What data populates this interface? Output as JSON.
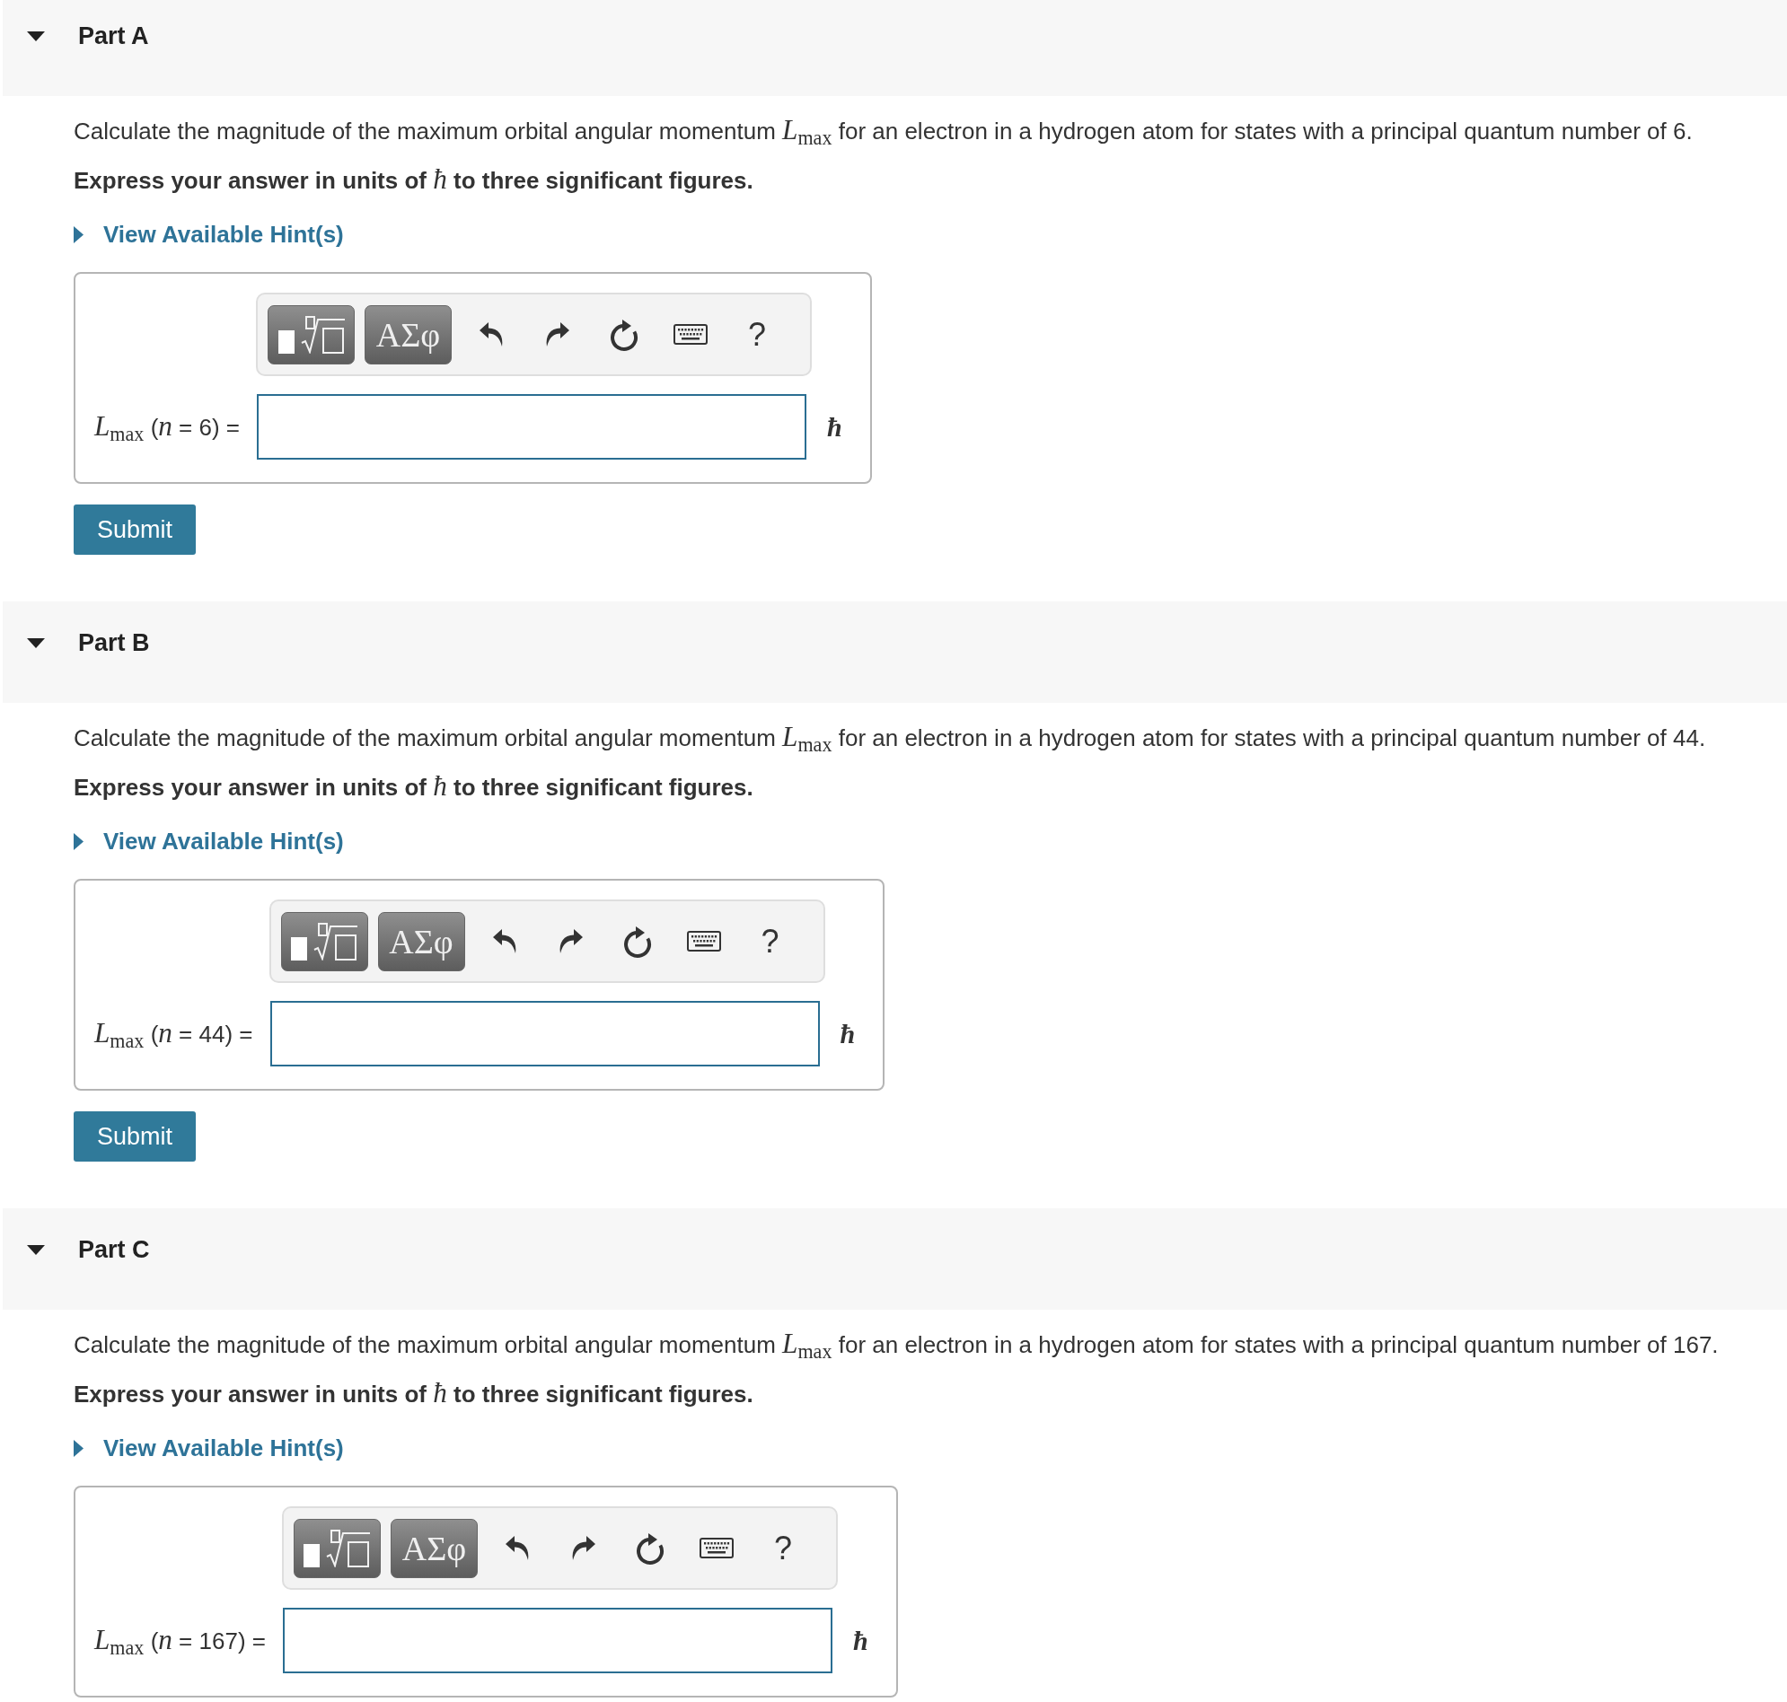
{
  "parts": [
    {
      "title": "Part A",
      "expanded": true,
      "question": "Calculate the magnitude of the maximum orbital angular momentum *L*$_{max}$ for an electron in a hydrogen atom for states with a principal quantum number of 6.",
      "instruction": "Express your answer in units of *ħ* to three significant figures.",
      "hint_link": "View Available Hint(s)",
      "toolbar": [
        {
          "kind": "templates"
        },
        {
          "kind": "symbols",
          "label": "ΑΣφ"
        },
        {
          "kind": "undo"
        },
        {
          "kind": "redo"
        },
        {
          "kind": "reset"
        },
        {
          "kind": "keyboard"
        },
        {
          "kind": "help",
          "label": "?"
        }
      ],
      "answer": {
        "label": "*L*$_{max}$ (*n* = 6) =",
        "unit": "ħ"
      },
      "submit": "Submit"
    },
    {
      "title": "Part B",
      "expanded": true,
      "question": "Calculate the magnitude of the maximum orbital angular momentum *L*$_{max}$ for an electron in a hydrogen atom for states with a principal quantum number of 44.",
      "instruction": "Express your answer in units of *ħ* to three significant figures.",
      "hint_link": "View Available Hint(s)",
      "toolbar": [
        {
          "kind": "templates"
        },
        {
          "kind": "symbols",
          "label": "ΑΣφ"
        },
        {
          "kind": "undo"
        },
        {
          "kind": "redo"
        },
        {
          "kind": "reset"
        },
        {
          "kind": "keyboard"
        },
        {
          "kind": "help",
          "label": "?"
        }
      ],
      "answer": {
        "label": "*L*$_{max}$ (*n* = 44) =",
        "unit": "ħ"
      },
      "submit": "Submit"
    },
    {
      "title": "Part C",
      "expanded": true,
      "question": "Calculate the magnitude of the maximum orbital angular momentum *L*$_{max}$ for an electron in a hydrogen atom for states with a principal quantum number of 167.",
      "instruction": "Express your answer in units of *ħ* to three significant figures.",
      "hint_link": "View Available Hint(s)",
      "toolbar": [
        {
          "kind": "templates"
        },
        {
          "kind": "symbols",
          "label": "ΑΣφ"
        },
        {
          "kind": "undo"
        },
        {
          "kind": "redo"
        },
        {
          "kind": "reset"
        },
        {
          "kind": "keyboard"
        },
        {
          "kind": "help",
          "label": "?"
        }
      ],
      "answer": {
        "label": "*L*$_{max}$ (*n* = 167) =",
        "unit": "ħ"
      }
    }
  ]
}
